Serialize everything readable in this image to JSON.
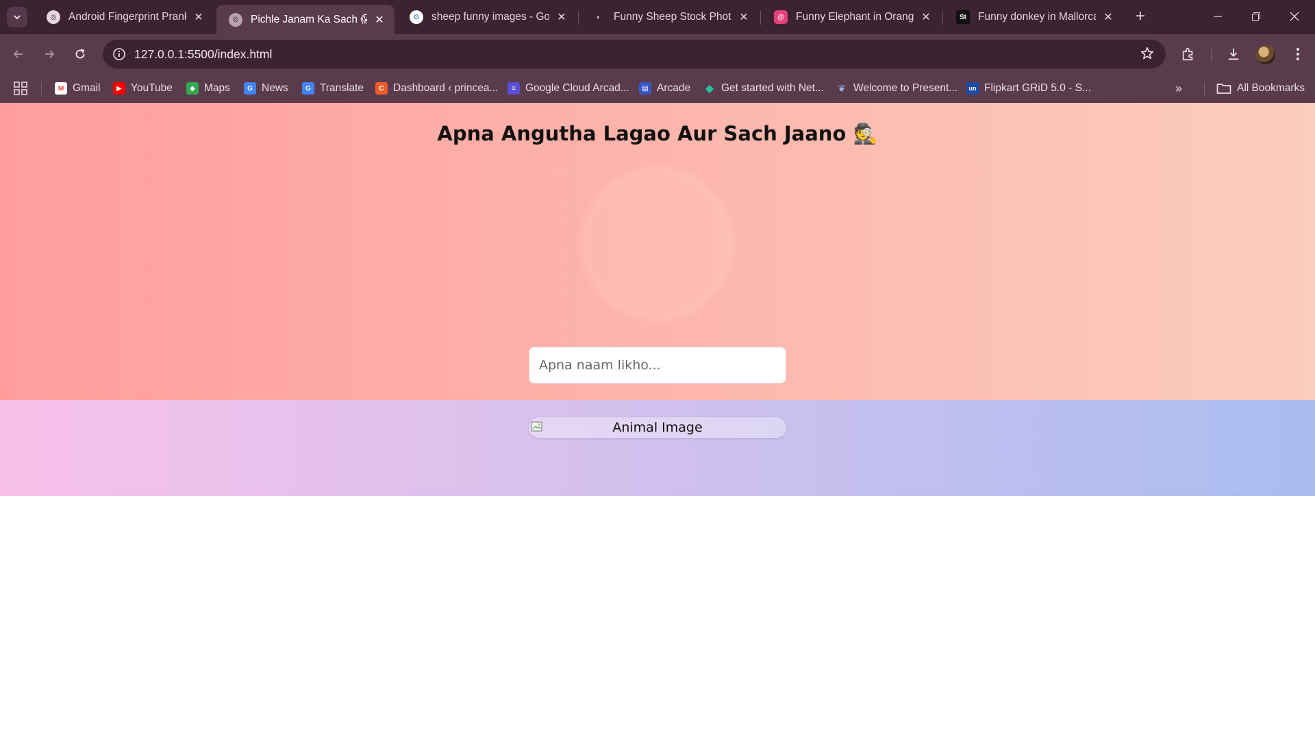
{
  "browser": {
    "tabs": [
      {
        "title": "Android Fingerprint Prank",
        "favicon": "globe-icon",
        "active": false
      },
      {
        "title": "Pichle Janam Ka Sach 😱",
        "favicon": "globe-icon",
        "active": true
      },
      {
        "title": "sheep funny images - Goo",
        "favicon": "google-icon",
        "active": false
      },
      {
        "title": "Funny Sheep Stock Photos",
        "favicon": "stock-icon",
        "active": false
      },
      {
        "title": "Funny Elephant in Orange",
        "favicon": "pink-swirl-icon",
        "active": false
      },
      {
        "title": "Funny donkey in Mallorca,",
        "favicon": "st-icon",
        "active": false
      }
    ],
    "url": "127.0.0.1:5500/index.html",
    "bookmarks": [
      {
        "label": "Gmail",
        "icon": "gmail-icon",
        "color": "#ea4335"
      },
      {
        "label": "YouTube",
        "icon": "youtube-icon",
        "color": "#ff0000"
      },
      {
        "label": "Maps",
        "icon": "maps-icon",
        "color": "#34a853"
      },
      {
        "label": "News",
        "icon": "news-icon",
        "color": "#4285f4"
      },
      {
        "label": "Translate",
        "icon": "translate-icon",
        "color": "#4285f4"
      },
      {
        "label": "Dashboard ‹ princea...",
        "icon": "dashboard-icon",
        "color": "#f05a28"
      },
      {
        "label": "Google Cloud Arcad...",
        "icon": "cloud-arcade-icon",
        "color": "#5a4fd6"
      },
      {
        "label": "Arcade",
        "icon": "arcade-icon",
        "color": "#3a56c5"
      },
      {
        "label": "Get started with Net...",
        "icon": "netlify-icon",
        "color": "#25c2a0"
      },
      {
        "label": "Welcome to Present...",
        "icon": "present-icon",
        "color": "#6b8fd6"
      },
      {
        "label": "Flipkart GRiD 5.0 - S...",
        "icon": "unstop-icon",
        "color": "#1c4aa8"
      }
    ],
    "all_bookmarks_label": "All Bookmarks",
    "more_label": "»"
  },
  "page": {
    "title": "Apna Angutha Lagao Aur Sach Jaano 🕵️",
    "name_placeholder": "Apna naam likho...",
    "image_alt": "Animal Image"
  }
}
